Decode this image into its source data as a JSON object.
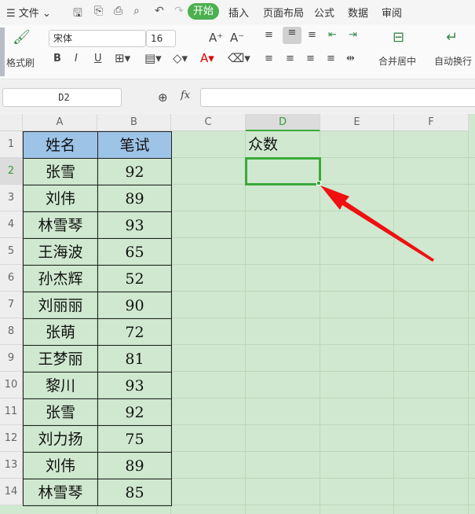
{
  "menu": {
    "file": "文件",
    "tabs": [
      "开始",
      "插入",
      "页面布局",
      "公式",
      "数据",
      "审阅"
    ]
  },
  "ribbon": {
    "format_painter": "格式刷",
    "font": "宋体",
    "size": "16",
    "merge": "合并居中",
    "wrap": "自动换行"
  },
  "formula": {
    "cell_ref": "D2",
    "fx": "fx",
    "value": ""
  },
  "columns": [
    "A",
    "B",
    "C",
    "D",
    "E",
    "F"
  ],
  "rows": [
    "1",
    "2",
    "3",
    "4",
    "5",
    "6",
    "7",
    "8",
    "9",
    "10",
    "11",
    "12",
    "13",
    "14"
  ],
  "table": {
    "headers": [
      "姓名",
      "笔试"
    ],
    "rows": [
      [
        "张雪",
        "92"
      ],
      [
        "刘伟",
        "89"
      ],
      [
        "林雪琴",
        "93"
      ],
      [
        "王海波",
        "65"
      ],
      [
        "孙杰辉",
        "52"
      ],
      [
        "刘丽丽",
        "90"
      ],
      [
        "张萌",
        "72"
      ],
      [
        "王梦丽",
        "81"
      ],
      [
        "黎川",
        "93"
      ],
      [
        "张雪",
        "92"
      ],
      [
        "刘力扬",
        "75"
      ],
      [
        "刘伟",
        "89"
      ],
      [
        "林雪琴",
        "85"
      ]
    ]
  },
  "d1": "众数",
  "colors": {
    "accent": "#4caf50",
    "header": "#9dc3e6",
    "grid": "#cfe8cf",
    "arrow": "#f01010"
  }
}
